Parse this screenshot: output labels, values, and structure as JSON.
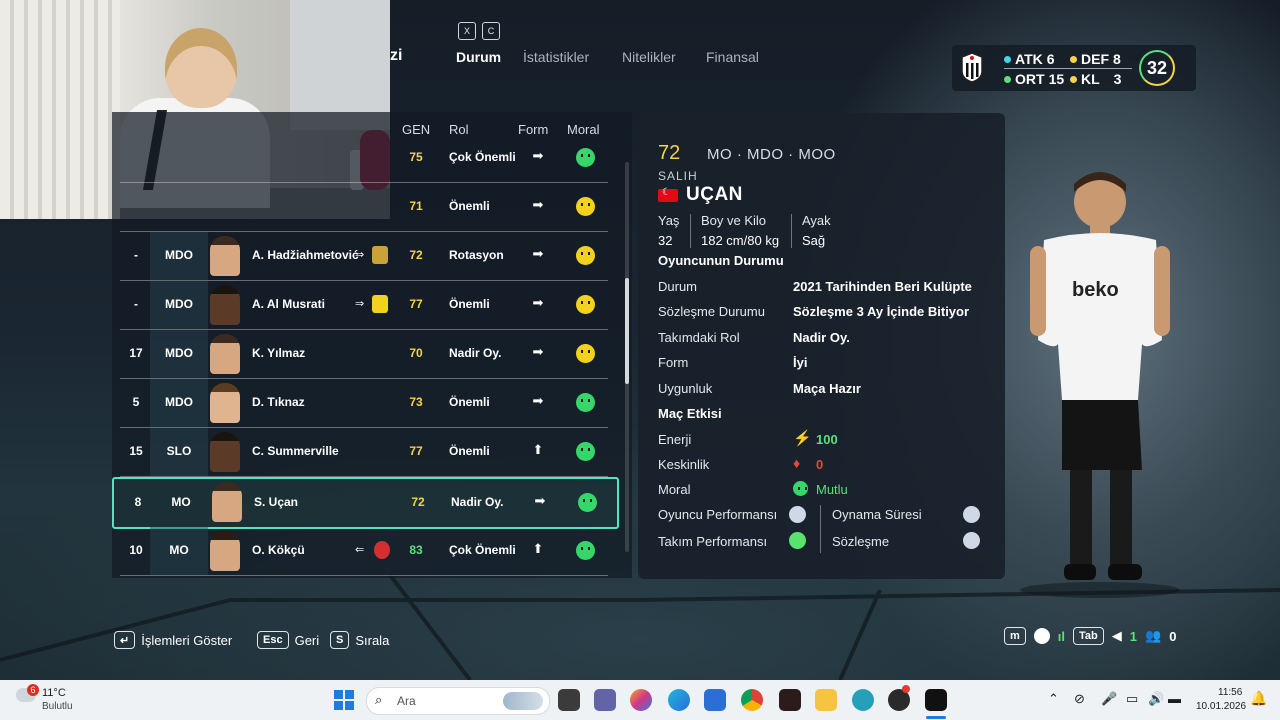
{
  "header": {
    "partial_title": "zi",
    "key_hint_left": "X",
    "key_hint_right": "C",
    "tabs": [
      {
        "label": "Durum",
        "active": true
      },
      {
        "label": "İstatistikler",
        "active": false
      },
      {
        "label": "Nitelikler",
        "active": false
      },
      {
        "label": "Finansal",
        "active": false
      }
    ]
  },
  "team": {
    "atk_label": "ATK",
    "atk": "6",
    "def_label": "DEF",
    "def": "8",
    "ort_label": "ORT",
    "ort": "15",
    "kl_label": "KL",
    "kl": "3",
    "overall": "32",
    "dot_colors": {
      "atk": "#3fd8e8",
      "def": "#f5d34a",
      "ort": "#5ce07a",
      "kl": "#f5d34a"
    }
  },
  "table": {
    "headers": {
      "gen": "GEN",
      "rol": "Rol",
      "form": "Form",
      "moral": "Moral"
    },
    "rows": [
      {
        "num": "",
        "pos": "",
        "name": "",
        "ovr": "75",
        "role": "Çok Önemli",
        "form": "right",
        "mood": "happy"
      },
      {
        "num": "",
        "pos": "",
        "name": "",
        "ovr": "71",
        "role": "Önemli",
        "form": "right",
        "mood": "neutral"
      },
      {
        "num": "-",
        "pos": "MDO",
        "name": "A. Hadžiahmetović",
        "ovr": "72",
        "role": "Rotasyon",
        "form": "right",
        "mood": "neutral",
        "transfer": "⇒"
      },
      {
        "num": "-",
        "pos": "MDO",
        "name": "A. Al Musrati",
        "ovr": "77",
        "role": "Önemli",
        "form": "right",
        "mood": "neutral",
        "transfer": "⇒"
      },
      {
        "num": "17",
        "pos": "MDO",
        "name": "K. Yılmaz",
        "ovr": "70",
        "role": "Nadir Oy.",
        "form": "right",
        "mood": "neutral"
      },
      {
        "num": "5",
        "pos": "MDO",
        "name": "D. Tıknaz",
        "ovr": "73",
        "role": "Önemli",
        "form": "right",
        "mood": "happy"
      },
      {
        "num": "15",
        "pos": "SLO",
        "name": "C. Summerville",
        "ovr": "77",
        "role": "Önemli",
        "form": "up",
        "mood": "happy"
      },
      {
        "num": "8",
        "pos": "MO",
        "name": "S. Uçan",
        "ovr": "72",
        "role": "Nadir Oy.",
        "form": "right",
        "mood": "happy",
        "selected": true
      },
      {
        "num": "10",
        "pos": "MO",
        "name": "O. Kökçü",
        "ovr": "83",
        "role": "Çok Önemli",
        "form": "up",
        "mood": "happy",
        "transfer": "⇐"
      }
    ]
  },
  "player": {
    "ovr": "72",
    "positions": "MO · MDO · MOO",
    "first_name": "SALIH",
    "last_name": "UÇAN",
    "age_label": "Yaş",
    "age": "32",
    "size_label": "Boy ve Kilo",
    "size": "182 cm/80 kg",
    "foot_label": "Ayak",
    "foot": "Sağ",
    "status_title": "Oyuncunun Durumu",
    "status_rows": [
      {
        "label": "Durum",
        "value": "2021 Tarihinden Beri Kulüpte"
      },
      {
        "label": "Sözleşme Durumu",
        "value": "Sözleşme 3 Ay İçinde Bitiyor"
      },
      {
        "label": "Takımdaki Rol",
        "value": "Nadir Oy."
      },
      {
        "label": "Form",
        "value": "İyi"
      },
      {
        "label": "Uygunluk",
        "value": "Maça Hazır"
      }
    ],
    "match_effect_title": "Maç Etkisi",
    "energy_label": "Enerji",
    "energy": "100",
    "sharpness_label": "Keskinlik",
    "sharpness": "0",
    "morale_label": "Moral",
    "morale": "Mutlu",
    "factors": {
      "player_perf": "Oyuncu Performansı",
      "play_time": "Oynama Süresi",
      "team_perf": "Takım Performansı",
      "contract": "Sözleşme"
    }
  },
  "footer": {
    "show_actions_key": "↵",
    "show_actions": "İşlemleri Göster",
    "back_key": "Esc",
    "back": "Geri",
    "sort_key": "S",
    "sort": "Sırala",
    "tab_key": "Tab",
    "count_a": "1",
    "count_b": "0"
  },
  "taskbar": {
    "weather_temp": "11°C",
    "weather_desc": "Bulutlu",
    "weather_badge": "6",
    "search_placeholder": "Ara",
    "time": "11:56",
    "date": "10.01.2026"
  }
}
